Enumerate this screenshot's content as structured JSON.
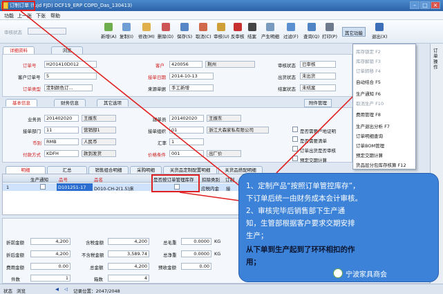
{
  "window": {
    "title": "订制订单 (fujd FJD) DCF19_ERP COPD_Das_130413)"
  },
  "menu": [
    "功能",
    "上一张",
    "下张",
    "帮助"
  ],
  "toolbar": {
    "status_label": "审核状态",
    "buttons": [
      "新增(A)",
      "复制(I)",
      "修改(M)",
      "删除(D)",
      "保存(S)",
      "取消(C)",
      "审核(U)",
      "反审核",
      "结案",
      "产生明细",
      "过滤(F)",
      "查询(Q)",
      "打印(P)",
      "其它功能",
      "退出(X)"
    ]
  },
  "main_tabs": [
    "详细资料",
    "浏览"
  ],
  "header": {
    "order_no_label": "订单号",
    "order_no": "H201410D012",
    "cust_order_label": "客户订单号",
    "cust_order": "5",
    "order_type_label": "订单类型",
    "order_type": "定制颜色订...",
    "customer_label": "客户",
    "customer_code": "420056",
    "customer_name": "荆州",
    "order_date_label": "接单日期",
    "order_date": "2014-10-13",
    "source_label": "来源单据",
    "source": "手工新增",
    "audit_label": "审核状态",
    "audit": "已审核",
    "ship_label": "出货状态",
    "ship": "未出货",
    "close_label": "结案状态",
    "close": "未结案"
  },
  "sub_tabs": [
    "基本信息",
    "财务信息",
    "其它选项"
  ],
  "attach_btn": "附件管理",
  "basic": {
    "sales_label": "业务员",
    "sales_code": "201402020",
    "sales_name": "王振东",
    "dept_label": "接单部门",
    "dept_code": "11",
    "dept_name": "营销部1",
    "currency_label": "币别",
    "currency_code": "RMB",
    "currency_name": "人民币",
    "pay_label": "付款方式",
    "pay_code": "KDFH",
    "pay_name": "款到发货",
    "follow_label": "跟单员",
    "follow_code": "201402020",
    "follow_name": "王振东",
    "org_label": "接单组织",
    "org_code": "01",
    "org_name": "浙江大森家私有限公司",
    "rate_label": "汇率",
    "rate": "1",
    "price_label": "价格条件",
    "price_code": "001",
    "price_name": "出厂价",
    "chk1": "是否需要产地证明",
    "chk2": "是否需要清单",
    "chk3": "订单出货是否审核",
    "chk4": "预定交期计算"
  },
  "detail_tabs": [
    "明细",
    "汇总",
    "销售组合明细",
    "采购明细",
    "关货品定制配置明细",
    "关货品搭配明细"
  ],
  "grid": {
    "headers": [
      "生产通知",
      "品号",
      "品名",
      "是否按订单管理库存",
      "扣除类别",
      "订制"
    ],
    "row": {
      "idx": "1",
      "prod_no": "D101251-17",
      "prod_name": "D010-CH-2(1.5)床",
      "category": "应税内金",
      "type": "接"
    }
  },
  "totals": {
    "r1": [
      [
        "折前金额",
        "4,200"
      ],
      [
        "含税金额",
        "4,200"
      ],
      [
        "总毛重",
        "0.0000",
        "KG"
      ]
    ],
    "r2": [
      [
        "折后金额",
        "4,200"
      ],
      [
        "不含税金额",
        "3,589.74"
      ],
      [
        "总净重",
        "0.0000",
        "KG"
      ]
    ],
    "r3": [
      [
        "费用金额",
        "0.00"
      ],
      [
        "总金额",
        "4,200"
      ],
      [
        "预收金额",
        "0.00"
      ]
    ],
    "r4": [
      [
        "件数",
        "1"
      ],
      [
        "箱数",
        "4"
      ]
    ]
  },
  "dropdown": [
    "库存锁定 F2",
    "库存解锁 F3",
    "订单转移 F4",
    "自动结合 F5",
    "生产通知 F6",
    "取消生产 F10",
    "费用管理 F8",
    "生产退出分析 F7",
    "订单明细查询",
    "订单BOM管理",
    "预定交期计算",
    "货品层分包库存核算 F12"
  ],
  "right_strip": "订单操作",
  "callout": {
    "l1": "1、定制产品“按照订单管控库存”，",
    "l2": "下订单后统一由财务成本会计审核。",
    "l3": "2、审核完毕后销售部下生产通",
    "l4": "知，生管部根据客户要求交期安排",
    "l5": "生产；",
    "l6": "从下单到生产起到了环环相扣的作",
    "l7": "用；"
  },
  "watermark": "宁波家具商会",
  "status": {
    "state_label": "状态",
    "state": "浏览",
    "record": "记录位置：2047/2048"
  },
  "colors": {
    "title": "#2c62a8",
    "callout": "#3c82d8",
    "highlight": "#e02020"
  }
}
